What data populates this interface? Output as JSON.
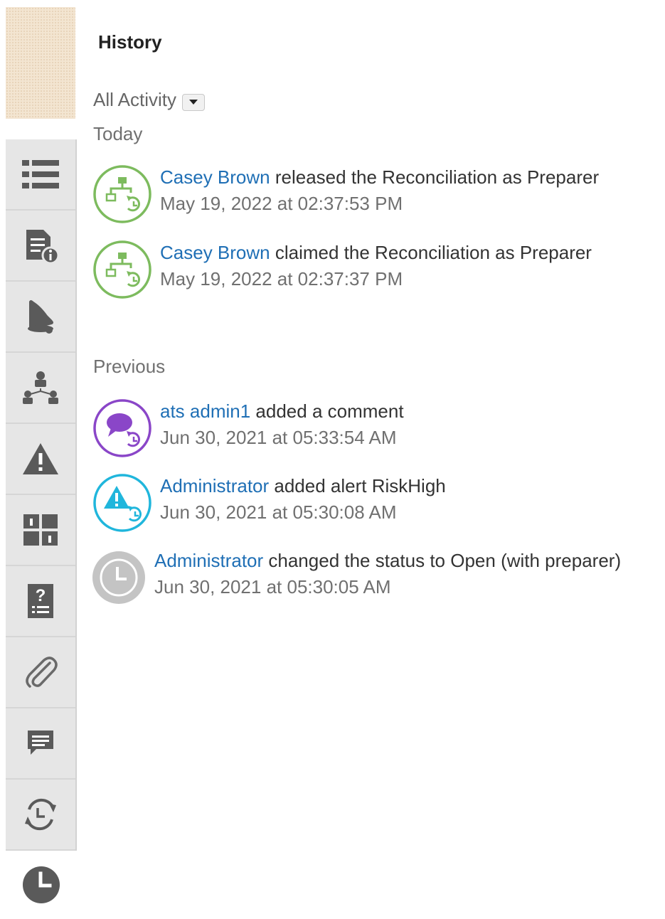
{
  "panel": {
    "title": "History",
    "filter_label": "All Activity"
  },
  "sections": {
    "today": "Today",
    "previous": "Previous"
  },
  "entries": [
    {
      "user": "Casey Brown",
      "action": "released the Reconciliation as Preparer",
      "time": "May 19, 2022 at 02:37:53 PM",
      "icon": "workflow-icon",
      "color": "#7dbb5e"
    },
    {
      "user": "Casey Brown",
      "action": "claimed the Reconciliation as Preparer",
      "time": "May 19, 2022 at 02:37:37 PM",
      "icon": "workflow-icon",
      "color": "#7dbb5e"
    },
    {
      "user": "ats admin1",
      "action": "added a comment",
      "time": "Jun 30, 2021 at 05:33:54 AM",
      "icon": "comment-icon",
      "color": "#8a46c8"
    },
    {
      "user": "Administrator",
      "action": "added alert RiskHigh",
      "time": "Jun 30, 2021 at 05:30:08 AM",
      "icon": "alert-icon",
      "color": "#20b6dc"
    },
    {
      "user": "Administrator",
      "action": "changed the status to Open (with preparer)",
      "time": "Jun 30, 2021 at 05:30:05 AM",
      "icon": "clock-icon",
      "color": "#c4c4c4"
    }
  ],
  "rail": {
    "items": [
      "list-icon",
      "document-info-icon",
      "bell-icon",
      "hierarchy-icon",
      "warning-icon",
      "grid-info-icon",
      "question-list-icon",
      "paperclip-icon",
      "chat-icon",
      "history-refresh-icon",
      "clock-icon"
    ],
    "active": "clock-icon"
  },
  "colors": {
    "link": "#1f6fb5",
    "rail_bg": "#e6e6e6",
    "icon_gray": "#5a5a5a"
  }
}
